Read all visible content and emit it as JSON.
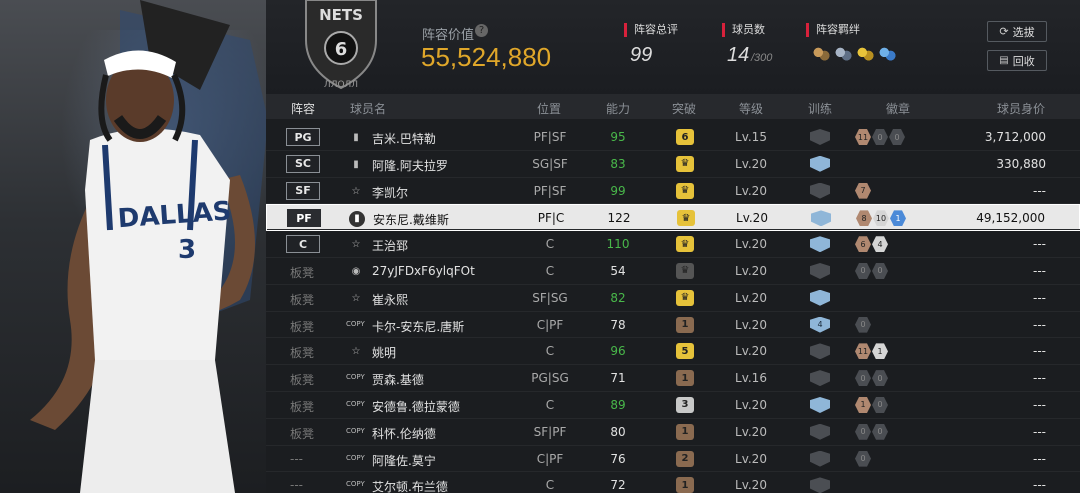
{
  "team": {
    "logo_text": "NETS",
    "logo_number": "6",
    "logo_sub": "ЛЛОЛЛ"
  },
  "lineup_value": {
    "label": "阵容价值",
    "value": "55,524,880"
  },
  "stats": [
    {
      "label": "阵容总评",
      "value": "99",
      "suffix": ""
    },
    {
      "label": "球员数",
      "value": "14",
      "suffix": "/300"
    },
    {
      "label": "阵容羁绊",
      "value": "",
      "suffix": ""
    }
  ],
  "buttons": {
    "select": "选拔",
    "recycle": "回收"
  },
  "columns": [
    "阵容",
    "球员名",
    "位置",
    "能力",
    "突破",
    "等级",
    "训练",
    "徽章",
    "球员身价"
  ],
  "rows": [
    {
      "slot": "PG",
      "name": "吉米.巴特勒",
      "position": "PF|SF",
      "ability": "95",
      "break": "6",
      "level": "Lv.15",
      "badges": [
        "11",
        "0",
        "0"
      ],
      "price": "3,712,000"
    },
    {
      "slot": "SC",
      "name": "阿隆.阿夫拉罗",
      "position": "SG|SF",
      "ability": "83",
      "break": "",
      "level": "Lv.20",
      "badges": [],
      "price": "330,880"
    },
    {
      "slot": "SF",
      "name": "李凯尔",
      "position": "PF|SF",
      "ability": "99",
      "break": "",
      "level": "Lv.20",
      "badges": [
        "7"
      ],
      "price": "---"
    },
    {
      "slot": "PF",
      "name": "安东尼.戴维斯",
      "position": "PF|C",
      "ability": "122",
      "break": "",
      "level": "Lv.20",
      "badges": [
        "8",
        "10",
        "1"
      ],
      "price": "49,152,000"
    },
    {
      "slot": "C",
      "name": "王治郅",
      "position": "C",
      "ability": "110",
      "break": "",
      "level": "Lv.20",
      "badges": [
        "6",
        "4"
      ],
      "price": "---"
    },
    {
      "slot": "板凳",
      "name": "27yJFDxF6ylqFOt",
      "position": "C",
      "ability": "54",
      "break": "",
      "level": "Lv.20",
      "badges": [
        "0",
        "0"
      ],
      "price": "---"
    },
    {
      "slot": "板凳",
      "name": "崔永熙",
      "position": "SF|SG",
      "ability": "82",
      "break": "",
      "level": "Lv.20",
      "badges": [],
      "price": "---"
    },
    {
      "slot": "板凳",
      "name": "卡尔-安东尼.唐斯",
      "position": "C|PF",
      "ability": "78",
      "break": "1",
      "level": "Lv.20",
      "train_value": "4",
      "badges": [
        "0"
      ],
      "price": "---"
    },
    {
      "slot": "板凳",
      "name": "姚明",
      "position": "C",
      "ability": "96",
      "break": "5",
      "level": "Lv.20",
      "badges": [
        "11",
        "1"
      ],
      "price": "---"
    },
    {
      "slot": "板凳",
      "name": "贾森.基德",
      "position": "PG|SG",
      "ability": "71",
      "break": "1",
      "level": "Lv.16",
      "badges": [
        "0",
        "0"
      ],
      "price": "---"
    },
    {
      "slot": "板凳",
      "name": "安德鲁.德拉蒙德",
      "position": "C",
      "ability": "89",
      "break": "3",
      "level": "Lv.20",
      "badges": [
        "1",
        "0"
      ],
      "price": "---"
    },
    {
      "slot": "板凳",
      "name": "科怀.伦纳德",
      "position": "SF|PF",
      "ability": "80",
      "break": "1",
      "level": "Lv.20",
      "badges": [
        "0",
        "0"
      ],
      "price": "---"
    },
    {
      "slot": "---",
      "name": "阿隆佐.莫宁",
      "position": "C|PF",
      "ability": "76",
      "break": "2",
      "level": "Lv.20",
      "badges": [
        "0"
      ],
      "price": "---"
    },
    {
      "slot": "---",
      "name": "艾尔顿.布兰德",
      "position": "C",
      "ability": "72",
      "break": "1",
      "level": "Lv.20",
      "badges": [],
      "price": "---"
    }
  ],
  "player_art": {
    "jersey_text": "DALLAS",
    "jersey_number": "3"
  },
  "colors": {
    "accent_gold": "#e0a72a",
    "accent_red": "#d8213b",
    "green": "#49b84a",
    "train_blue": "#8fb6d8"
  }
}
